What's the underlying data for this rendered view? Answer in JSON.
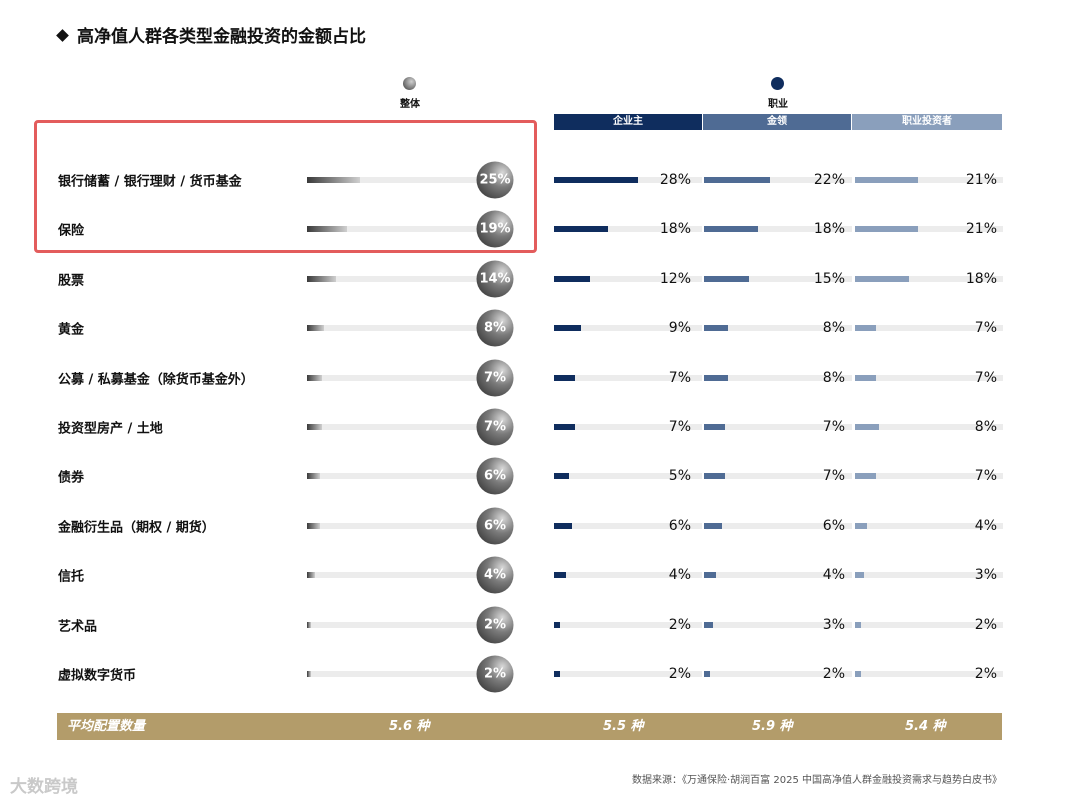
{
  "title": "高净值人群各类型金融投资的金额占比",
  "legend": {
    "overall": "整体",
    "occupation": "职业"
  },
  "headers": [
    "企业主",
    "金领",
    "职业投资者"
  ],
  "colors": {
    "entrepreneur": "#0f2d5e",
    "white_collar": "#4f6b94",
    "investor": "#8a9fbc",
    "footer": "#b39c6a",
    "highlight": "#e35c5c"
  },
  "chart_data": {
    "type": "bar",
    "title": "高净值人群各类型金融投资的金额占比",
    "categories": [
      "银行储蓄 / 银行理财 / 货币基金",
      "保险",
      "股票",
      "黄金",
      "公募 / 私募基金（除货币基金外）",
      "投资型房产 / 土地",
      "债券",
      "金融衍生品（期权 / 期货）",
      "信托",
      "艺术品",
      "虚拟数字货币"
    ],
    "units": "%",
    "series": [
      {
        "name": "整体",
        "values": [
          25,
          19,
          14,
          8,
          7,
          7,
          6,
          6,
          4,
          2,
          2
        ]
      },
      {
        "name": "企业主",
        "values": [
          28,
          18,
          12,
          9,
          7,
          7,
          5,
          6,
          4,
          2,
          2
        ]
      },
      {
        "name": "金领",
        "values": [
          22,
          18,
          15,
          8,
          8,
          7,
          7,
          6,
          4,
          3,
          2
        ]
      },
      {
        "name": "职业投资者",
        "values": [
          21,
          21,
          18,
          7,
          7,
          8,
          7,
          4,
          3,
          2,
          2
        ]
      }
    ],
    "rows": [
      {
        "label": "银行储蓄 / 银行理财 / 货币基金",
        "overall": "25%",
        "entrepreneur": "28%",
        "white_collar": "22%",
        "investor": "21%"
      },
      {
        "label": "保险",
        "overall": "19%",
        "entrepreneur": "18%",
        "white_collar": "18%",
        "investor": "21%"
      },
      {
        "label": "股票",
        "overall": "14%",
        "entrepreneur": "12%",
        "white_collar": "15%",
        "investor": "18%"
      },
      {
        "label": "黄金",
        "overall": "8%",
        "entrepreneur": "9%",
        "white_collar": "8%",
        "investor": "7%"
      },
      {
        "label": "公募 / 私募基金（除货币基金外）",
        "overall": "7%",
        "entrepreneur": "7%",
        "white_collar": "8%",
        "investor": "7%"
      },
      {
        "label": "投资型房产 / 土地",
        "overall": "7%",
        "entrepreneur": "7%",
        "white_collar": "7%",
        "investor": "8%"
      },
      {
        "label": "债券",
        "overall": "6%",
        "entrepreneur": "5%",
        "white_collar": "7%",
        "investor": "7%"
      },
      {
        "label": "金融衍生品（期权 / 期货）",
        "overall": "6%",
        "entrepreneur": "6%",
        "white_collar": "6%",
        "investor": "4%"
      },
      {
        "label": "信托",
        "overall": "4%",
        "entrepreneur": "4%",
        "white_collar": "4%",
        "investor": "3%"
      },
      {
        "label": "艺术品",
        "overall": "2%",
        "entrepreneur": "2%",
        "white_collar": "3%",
        "investor": "2%"
      },
      {
        "label": "虚拟数字货币",
        "overall": "2%",
        "entrepreneur": "2%",
        "white_collar": "2%",
        "investor": "2%"
      }
    ],
    "footer": {
      "label": "平均配置数量",
      "overall": "5.6 种",
      "entrepreneur": "5.5 种",
      "white_collar": "5.9 种",
      "investor": "5.4 种"
    }
  },
  "source": "数据来源：《万通保险·胡润百富 2025 中国高净值人群金融投资需求与趋势白皮书》",
  "watermark": "大数跨境"
}
